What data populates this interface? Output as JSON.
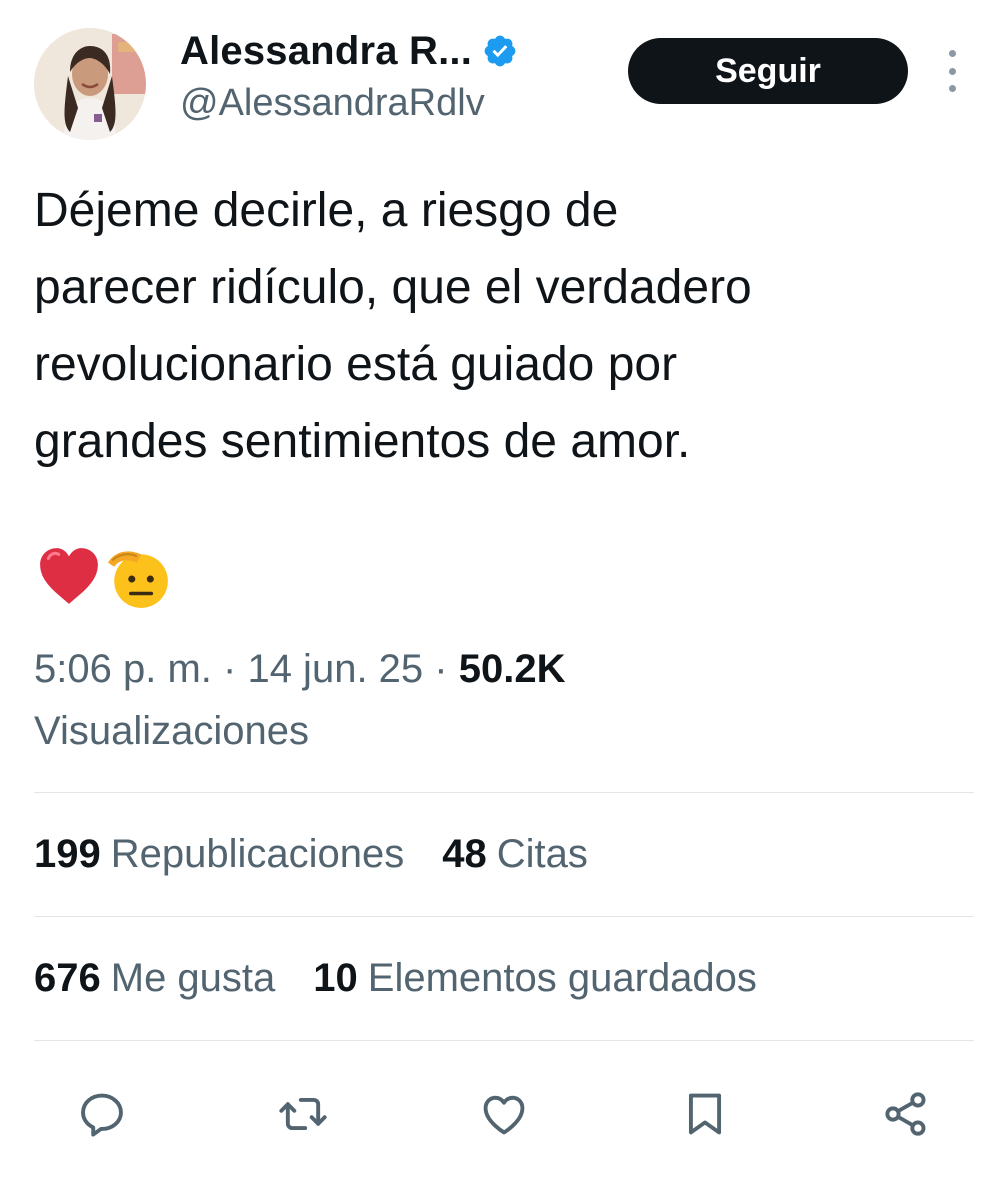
{
  "author": {
    "display_name": "Alessandra R...",
    "handle": "@AlessandraRdlv",
    "verified": true,
    "avatar_icon": "profile-photo"
  },
  "follow_label": "Seguir",
  "tweet": {
    "text": "Déjeme decirle, a riesgo de\nparecer ridículo, que el verdadero\nrevolucionario está guiado por\ngrandes sentimientos de amor.",
    "emojis": [
      "❤️",
      "🫡"
    ]
  },
  "meta": {
    "time": "5:06 p. m.",
    "separator": "·",
    "date": "14 jun. 25",
    "views_count": "50.2K",
    "views_label": "Visualizaciones"
  },
  "stats": {
    "reposts_count": "199",
    "reposts_label": "Republicaciones",
    "quotes_count": "48",
    "quotes_label": "Citas",
    "likes_count": "676",
    "likes_label": "Me gusta",
    "bookmarks_count": "10",
    "bookmarks_label": "Elementos guardados"
  },
  "actions": [
    "reply-icon",
    "repost-icon",
    "like-icon",
    "bookmark-icon",
    "share-icon"
  ],
  "colors": {
    "text_primary": "#0f1419",
    "text_secondary": "#536471",
    "verified_blue": "#1d9bf0",
    "button_dark": "#0f1419",
    "divider": "#e1e6ea"
  }
}
